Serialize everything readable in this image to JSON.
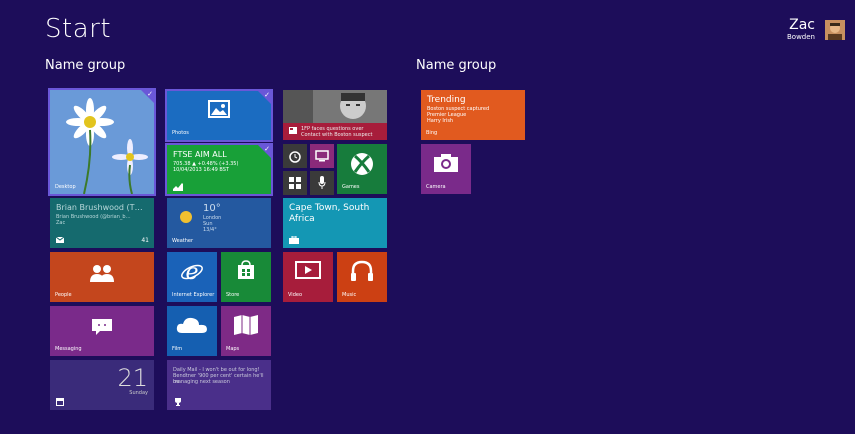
{
  "screen": {
    "title": "Start"
  },
  "groups": [
    {
      "label": "Name group"
    },
    {
      "label": "Name group"
    }
  ],
  "user": {
    "name": "Zac",
    "subtitle": "Bowden"
  },
  "tiles": {
    "desktop": {
      "label": "Desktop"
    },
    "photos": {
      "label": "Photos"
    },
    "finance": {
      "title": "FTSE AIM ALL",
      "line1": "705.38 ▲ +0.48% (+3.35)",
      "line2": "10/04/2013 16:49 BST"
    },
    "people_feed": {
      "line1": "1FP faces questions over",
      "line2": "Contact with Boston suspect"
    },
    "mail": {
      "line1": "Brian Brushwood (T…",
      "line2": "Brian Brushwood (@brian_b…",
      "line3": "Zac",
      "count": "41"
    },
    "weather": {
      "temp": "10°",
      "city": "London",
      "detail1": "Sun",
      "detail2": "13/4°",
      "label": "Weather"
    },
    "games": {
      "label": "Games"
    },
    "travel": {
      "title": "Cape Town, South Africa"
    },
    "people": {
      "label": "People"
    },
    "ie": {
      "label": "Internet Explorer"
    },
    "store": {
      "label": "Store"
    },
    "video": {
      "label": "Video"
    },
    "music": {
      "label": "Music"
    },
    "messaging": {
      "label": "Messaging"
    },
    "film": {
      "label": "Film"
    },
    "maps": {
      "label": "Maps"
    },
    "calendar": {
      "day": "21",
      "weekday": "Sunday"
    },
    "sport": {
      "line1": "Daily Mail - I won't be out for long!",
      "line2": "Bendtner '900 per cent' certain he'll be",
      "line3": "managing next season"
    },
    "bing": {
      "title": "Trending",
      "line1": "Boston suspect captured",
      "line2": "Premier League",
      "line3": "Harry Irish",
      "label": "Bing"
    },
    "camera": {
      "label": "Camera"
    }
  },
  "colors": {
    "background": "#1d0d5a",
    "selection": "#6a57d8",
    "desktop": "#5e8fd2",
    "photos": "#1b6cc1",
    "finance": "#18a038",
    "mail": "#156a6e",
    "weather": "#2459a0",
    "games": "#177c3c",
    "travel": "#1497b4",
    "people": "#c4461d",
    "ie": "#1a62b8",
    "store": "#188a38",
    "video": "#a71d3b",
    "music": "#cc4013",
    "messaging": "#7a2a8a",
    "film": "#155fb1",
    "maps": "#7e2a86",
    "calendar": "#3a2b7a",
    "sport": "#4a2f8a",
    "bing": "#e15a1f",
    "camera": "#7a2a8a"
  }
}
